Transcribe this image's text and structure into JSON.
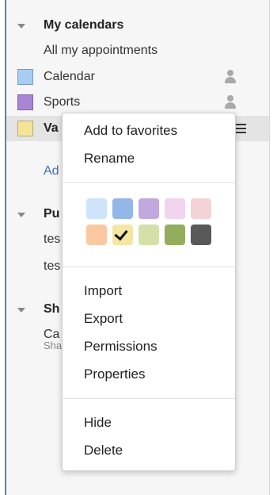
{
  "sidebar": {
    "my_calendars": {
      "title": "My calendars",
      "all_appointments": "All my appointments",
      "items": [
        {
          "label": "Calendar",
          "color": "#a8cdf5"
        },
        {
          "label": "Sports",
          "color": "#a886d6"
        },
        {
          "label": "Vacation",
          "color": "#f5e39a",
          "visible_label": "Va"
        }
      ],
      "add_link": "Ad"
    },
    "public": {
      "title": "Pu",
      "items": [
        "tes",
        "tes"
      ]
    },
    "shared": {
      "title": "Sh",
      "item": "Ca",
      "sub": "Sha"
    }
  },
  "context_menu": {
    "add_to_favorites": "Add to favorites",
    "rename": "Rename",
    "colors": [
      "#cfe3fb",
      "#93b8e7",
      "#c3a8df",
      "#f1d4ee",
      "#f3d3d5",
      "#fac9a1",
      "#f6e6a4",
      "#d5e0a8",
      "#94ad5d",
      "#595959"
    ],
    "selected_color_index": 6,
    "import": "Import",
    "export": "Export",
    "permissions": "Permissions",
    "properties": "Properties",
    "hide": "Hide",
    "delete": "Delete"
  },
  "icons": {
    "shared_user": "person-icon",
    "options": "hamburger-menu-icon",
    "expand": "triangle-down-icon",
    "checkmark": "checkmark-icon"
  },
  "accent_color": "#3a73b8"
}
